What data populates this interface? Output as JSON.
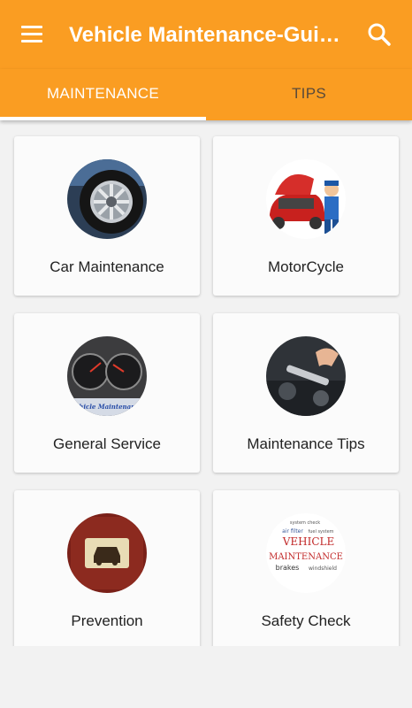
{
  "app": {
    "title": "Vehicle Maintenance-Gui…",
    "accent_color": "#fa9d22",
    "menu_icon": "hamburger-menu-icon",
    "search_icon": "search-icon"
  },
  "tabs": [
    {
      "label": "MAINTENANCE",
      "selected": true
    },
    {
      "label": "TIPS",
      "selected": false
    }
  ],
  "cards": [
    {
      "label": "Car Maintenance",
      "image": "car-wheel-tire-image"
    },
    {
      "label": "MotorCycle",
      "image": "mechanic-cartoon-image"
    },
    {
      "label": "General Service",
      "image": "dashboard-gauges-image",
      "image_text": "Vehicle Maintenance"
    },
    {
      "label": "Maintenance Tips",
      "image": "wrench-engine-image"
    },
    {
      "label": "Prevention",
      "image": "car-warning-icon-image"
    },
    {
      "label": "Safety Check",
      "image": "word-cloud-image",
      "image_text": [
        "VEHICLE",
        "MAINTENANCE",
        "brakes",
        "air filter",
        "windshield",
        "fuel system",
        "system check"
      ]
    }
  ]
}
